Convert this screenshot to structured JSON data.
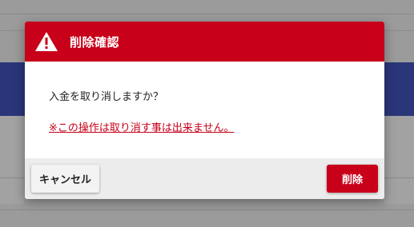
{
  "dialog": {
    "title": "削除確認",
    "icon": "warning-icon",
    "message": "入金を取り消しますか？",
    "warning": "※この操作は取り消す事は出来ません。",
    "cancel_label": "キャンセル",
    "delete_label": "削除"
  },
  "colors": {
    "accent": "#c8001a",
    "overlay": "#9b9b9b",
    "background_band": "#2a3679"
  }
}
